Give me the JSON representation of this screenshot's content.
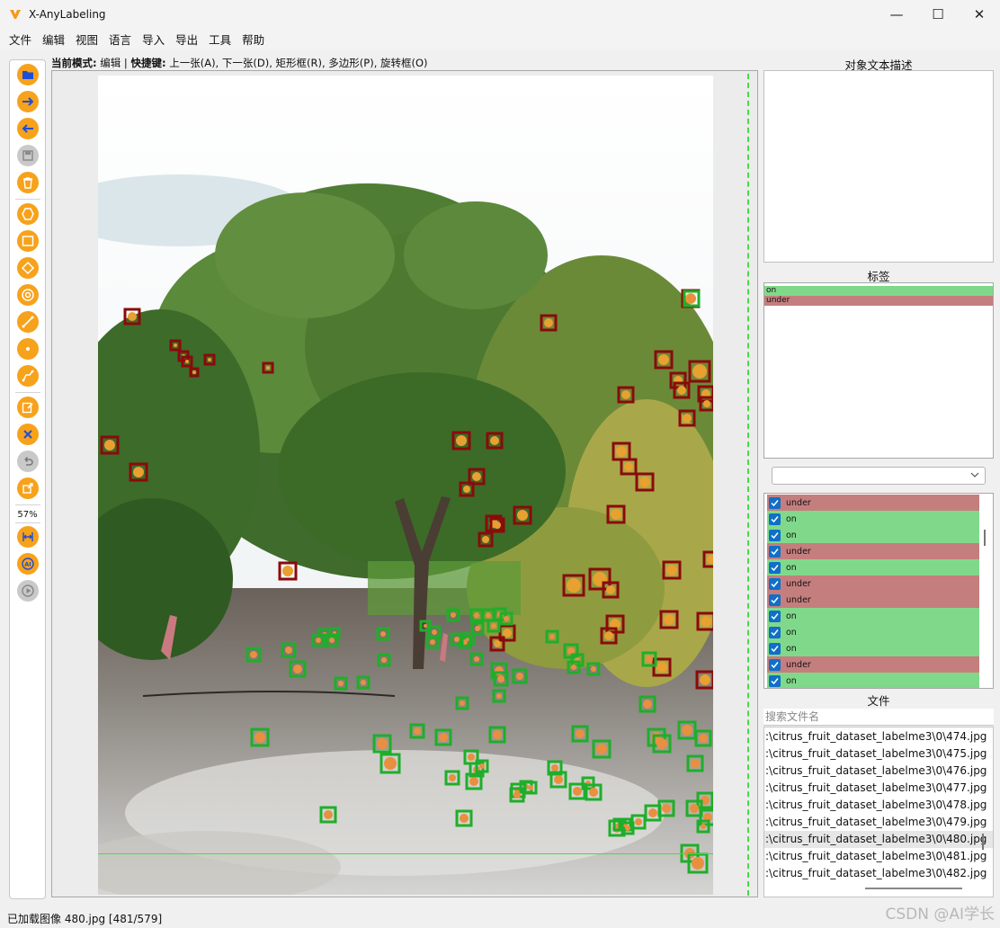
{
  "window": {
    "title": "X-AnyLabeling"
  },
  "window_controls": {
    "minimize": "—",
    "maximize": "☐",
    "close": "✕"
  },
  "menu": [
    "文件",
    "编辑",
    "视图",
    "语言",
    "导入",
    "导出",
    "工具",
    "帮助"
  ],
  "toolbar": {
    "zoom": "57%",
    "tools": [
      "open-folder-icon",
      "next-image-icon",
      "prev-image-icon",
      "save-icon",
      "delete-icon",
      "polygon-icon",
      "rectangle-icon",
      "rotation-icon",
      "circle-icon",
      "line-icon",
      "point-icon",
      "linestrip-icon",
      "edit-icon",
      "cancel-icon",
      "undo-icon",
      "brightness-icon",
      "fit-width-icon",
      "ai-icon",
      "run-icon"
    ]
  },
  "mode_bar": {
    "mode_label": "当前模式:",
    "mode_value": "编辑",
    "separator": "|",
    "shortcut_label": "快捷键:",
    "shortcuts": "上一张(A), 下一张(D), 矩形框(R), 多边形(P), 旋转框(O)"
  },
  "panels": {
    "description_title": "对象文本描述",
    "labels_title": "标签",
    "files_title": "文件"
  },
  "labels": [
    {
      "name": "on",
      "color": "#80d98a"
    },
    {
      "name": "under",
      "color": "#c57e7e"
    }
  ],
  "shapes": [
    "under",
    "on",
    "on",
    "under",
    "on",
    "under",
    "under",
    "on",
    "on",
    "on",
    "under",
    "on"
  ],
  "shape_colors": {
    "on": "#80d98a",
    "under": "#c57e7e"
  },
  "files": {
    "search_placeholder": "搜索文件名",
    "items": [
      ":\\citrus_fruit_dataset_labelme3\\0\\474.jpg",
      ":\\citrus_fruit_dataset_labelme3\\0\\475.jpg",
      ":\\citrus_fruit_dataset_labelme3\\0\\476.jpg",
      ":\\citrus_fruit_dataset_labelme3\\0\\477.jpg",
      ":\\citrus_fruit_dataset_labelme3\\0\\478.jpg",
      ":\\citrus_fruit_dataset_labelme3\\0\\479.jpg",
      ":\\citrus_fruit_dataset_labelme3\\0\\480.jpg",
      ":\\citrus_fruit_dataset_labelme3\\0\\481.jpg",
      ":\\citrus_fruit_dataset_labelme3\\0\\482.jpg"
    ],
    "selected_index": 6
  },
  "status": "已加载图像 480.jpg [481/579]",
  "watermark": "CSDN @AI学长",
  "colors": {
    "accent": "#f7a21b",
    "box_on": "#1fae2a",
    "box_under": "#8b0a0a",
    "checkbox": "#0f6fc9"
  }
}
